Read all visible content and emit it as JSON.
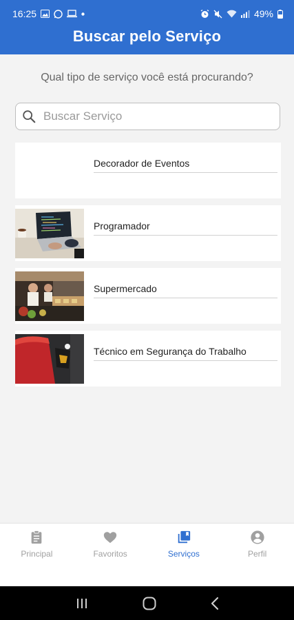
{
  "status_bar": {
    "time": "16:25",
    "battery": "49%"
  },
  "header": {
    "title": "Buscar pelo Serviço"
  },
  "main": {
    "question": "Qual tipo de serviço você está procurando?",
    "search": {
      "placeholder": "Buscar Serviço",
      "value": ""
    },
    "services": [
      {
        "label": "Decorador de Eventos"
      },
      {
        "label": "Programador"
      },
      {
        "label": "Supermercado"
      },
      {
        "label": "Técnico em Segurança do Trabalho"
      }
    ]
  },
  "bottom_nav": {
    "items": [
      {
        "label": "Principal",
        "icon": "clipboard-icon"
      },
      {
        "label": "Favoritos",
        "icon": "heart-icon"
      },
      {
        "label": "Serviços",
        "icon": "library-icon",
        "active": true
      },
      {
        "label": "Perfil",
        "icon": "account-icon"
      }
    ]
  },
  "colors": {
    "primary": "#2f6fd0",
    "inactive": "#a0a0a0",
    "background": "#f3f3f3"
  }
}
